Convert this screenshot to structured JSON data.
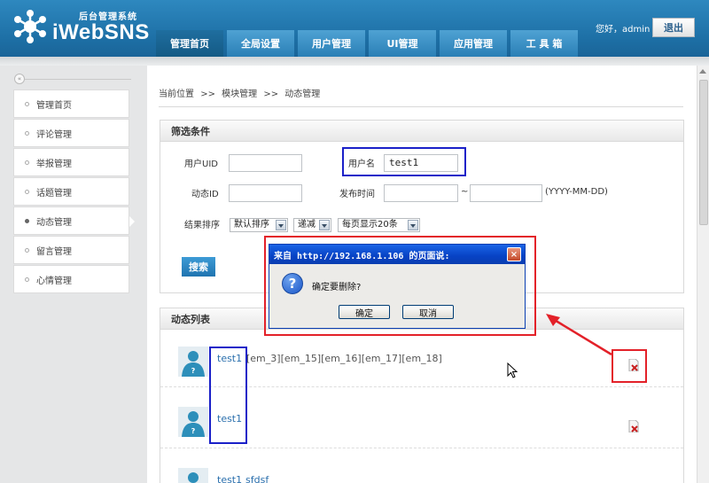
{
  "header": {
    "logo_sub": "后台管理系统",
    "logo_main": "iWebSNS",
    "nav": [
      "管理首页",
      "全局设置",
      "用户管理",
      "UI管理",
      "应用管理",
      "工 具 箱"
    ],
    "greeting": "您好，admin",
    "logout": "退出"
  },
  "sidebar": {
    "collapse_icon": "«",
    "items": [
      "管理首页",
      "评论管理",
      "举报管理",
      "话题管理",
      "动态管理",
      "留言管理",
      "心情管理"
    ],
    "active": "动态管理"
  },
  "breadcrumb": [
    "当前位置",
    ">>",
    "模块管理",
    ">>",
    "动态管理"
  ],
  "filter": {
    "title": "筛选条件",
    "uid_label": "用户UID",
    "uid_value": "",
    "username_label": "用户名",
    "username_value": "test1",
    "feed_id_label": "动态ID",
    "feed_id_value": "",
    "time_label": "发布时间",
    "time_from": "",
    "time_sep": "~",
    "time_to": "",
    "time_hint": "(YYYY-MM-DD)",
    "sort_label": "结果排序",
    "sort_field": "默认排序",
    "sort_order": "递减",
    "page_size": "每页显示20条",
    "search_button": "搜索"
  },
  "list": {
    "title": "动态列表",
    "rows": [
      {
        "user": "test1",
        "text": "[em_3][em_15][em_16][em_17][em_18]"
      },
      {
        "user": "test1",
        "text": ""
      },
      {
        "user": "test1",
        "text": "sfdsf"
      }
    ]
  },
  "dialog": {
    "title": "来自 http://192.168.1.106 的页面说:",
    "message": "确定要删除?",
    "ok": "确定",
    "cancel": "取消",
    "close": "×",
    "icon": "?"
  },
  "colors": {
    "header_blue": "#1d6fa5",
    "dialog_title_blue": "#0742c4",
    "annotation_red": "#e32129",
    "annotation_blue": "#1a20c8"
  }
}
